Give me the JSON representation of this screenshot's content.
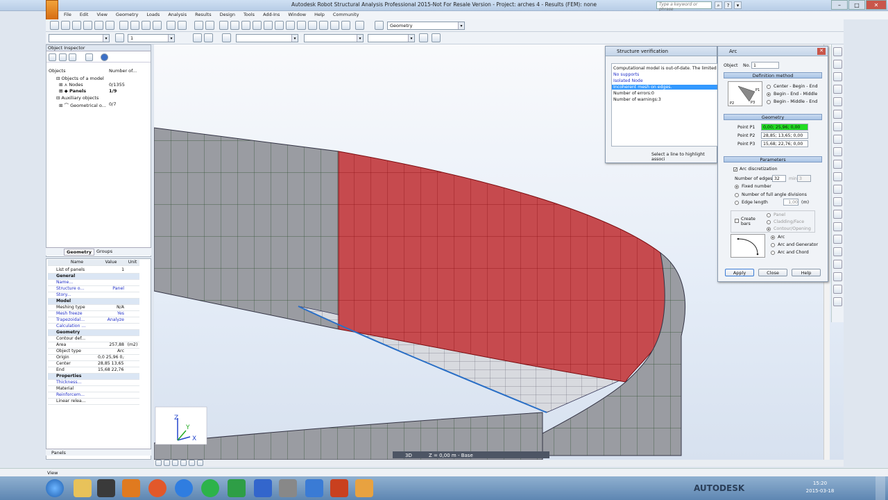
{
  "titlebar": {
    "title": "Autodesk Robot Structural Analysis Professional 2015-Not For Resale Version - Project: arches 4 - Results (FEM): none",
    "search_placeholder": "Type a keyword or phrase"
  },
  "menu": [
    "File",
    "Edit",
    "View",
    "Geometry",
    "Loads",
    "Analysis",
    "Results",
    "Design",
    "Tools",
    "Add-Ins",
    "Window",
    "Help",
    "Community"
  ],
  "toolbar": {
    "layout_combo": "Geometry",
    "combo_1": "1"
  },
  "object_inspector": {
    "title": "Object Inspector",
    "columns": [
      "Objects",
      "Number of..."
    ],
    "tree": [
      {
        "label": "Objects of a model",
        "value": ""
      },
      {
        "label": "Nodes",
        "value": "0/1355"
      },
      {
        "label": "Panels",
        "value": "1/9"
      },
      {
        "label": "Auxiliary objects",
        "value": ""
      },
      {
        "label": "Geometrical o...",
        "value": "0/7"
      }
    ],
    "tabs": [
      "Geometry",
      "Groups"
    ]
  },
  "properties": {
    "columns": [
      "Name",
      "Value",
      "Unit"
    ],
    "rows": [
      {
        "n": "List of panels",
        "v": "1",
        "u": "",
        "kind": "top"
      },
      {
        "n": "General",
        "v": "",
        "u": "",
        "kind": "sec"
      },
      {
        "n": "Name...",
        "v": "",
        "u": "",
        "kind": "blue"
      },
      {
        "n": "Structure o...",
        "v": "Panel",
        "u": "",
        "kind": "blue"
      },
      {
        "n": "Story...",
        "v": "",
        "u": "",
        "kind": "blue"
      },
      {
        "n": "Model",
        "v": "",
        "u": "",
        "kind": "sec"
      },
      {
        "n": "Meshing type",
        "v": "N/A",
        "u": "",
        "kind": ""
      },
      {
        "n": "Mesh freeze",
        "v": "Yes",
        "u": "",
        "kind": "blue"
      },
      {
        "n": "Trapezoidal...",
        "v": "Analyze",
        "u": "",
        "kind": "blue"
      },
      {
        "n": "Calculation ...",
        "v": "",
        "u": "",
        "kind": "blue"
      },
      {
        "n": "Geometry",
        "v": "",
        "u": "",
        "kind": "sec"
      },
      {
        "n": "Contour def...",
        "v": "",
        "u": "",
        "kind": ""
      },
      {
        "n": "Area",
        "v": "257,88",
        "u": "(m2)",
        "kind": ""
      },
      {
        "n": "Object type",
        "v": "Arc",
        "u": "",
        "kind": ""
      },
      {
        "n": "Origin",
        "v": "0,0 25,96 0,0",
        "u": "",
        "kind": ""
      },
      {
        "n": "Center",
        "v": "28,85 13,65 0,0",
        "u": "",
        "kind": ""
      },
      {
        "n": "End",
        "v": "15,68 22,76 0,0",
        "u": "",
        "kind": ""
      },
      {
        "n": "Properties",
        "v": "",
        "u": "",
        "kind": "sec"
      },
      {
        "n": "Thickness...",
        "v": "",
        "u": "",
        "kind": "blue"
      },
      {
        "n": "Material",
        "v": "",
        "u": "",
        "kind": ""
      },
      {
        "n": "Reinforcem...",
        "v": "",
        "u": "",
        "kind": "blue"
      },
      {
        "n": "Linear relea...",
        "v": "",
        "u": "",
        "kind": ""
      }
    ],
    "tab": "Panels"
  },
  "structure_verification": {
    "title": "Structure verification",
    "items": [
      "Computational model is out-of-date. The limited ver",
      "No supports",
      "Isolated Node",
      "Incoherent mesh on edges.",
      "Number of errors:0",
      "Number of warnings:3"
    ],
    "footer": "Select a line to highlight associ"
  },
  "arc_dialog": {
    "title": "Arc",
    "object_label": "Object",
    "object_no_label": "No.",
    "object_no": "1",
    "definition_method": "Definition method",
    "methods": [
      "Center - Begin - End",
      "Begin - End - Middle",
      "Begin - Middle - End"
    ],
    "geometry": "Geometry",
    "points": [
      {
        "label": "Point P1",
        "value": "0,00; 25,96; 0,00"
      },
      {
        "label": "Point P2",
        "value": "28,85; 13,65; 0,00"
      },
      {
        "label": "Point P3",
        "value": "15,68; 22,76; 0,00"
      }
    ],
    "parameters": "Parameters",
    "arc_discretization": "Arc discretization",
    "number_of_edges_label": "Number of edges:",
    "number_of_edges": "32",
    "min_label": "min",
    "min_value": "3",
    "fixed_number": "Fixed number",
    "full_angle": "Number of full angle divisions",
    "edge_length": "Edge length",
    "edge_length_value": "1,00",
    "edge_length_unit": "(m)",
    "create_bars": "Create bars",
    "bar_opts": [
      "Panel",
      "Cladding/Face",
      "Contour/Opening"
    ],
    "arc_types": [
      "Arc",
      "Arc and Generator",
      "Arc and Chord"
    ],
    "buttons": [
      "Apply",
      "Close",
      "Help"
    ],
    "diagram_labels": [
      "P1",
      "P2",
      "P3"
    ]
  },
  "viewport": {
    "view_mode": "3D",
    "level": "Z = 0,00 m - Base",
    "axes": [
      "Z",
      "Y",
      "X"
    ]
  },
  "status": {
    "left": "View"
  },
  "taskbar": {
    "time": "15:20",
    "date": "2015-03-18",
    "brand": "AUTODESK"
  },
  "colors": {
    "selected_panel": "#c64a4e",
    "panel": "#9a9ca2",
    "highlight": "#3399ff",
    "green_field": "#22dd22"
  }
}
